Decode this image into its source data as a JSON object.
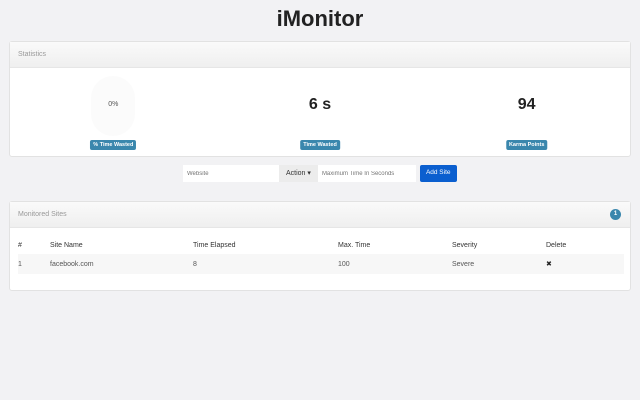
{
  "title": "iMonitor",
  "statistics": {
    "header": "Statistics",
    "percent_value": "0%",
    "percent_label": "% Time Wasted",
    "time_value": "6 s",
    "time_label": "Time Wasted",
    "karma_value": "94",
    "karma_label": "Karma Points"
  },
  "form": {
    "website_placeholder": "Website",
    "action_label": "Action",
    "max_time_placeholder": "Maximum Time In Seconds",
    "add_label": "Add Site"
  },
  "sites": {
    "header": "Monitored Sites",
    "count": "1",
    "columns": [
      "#",
      "Site Name",
      "Time Elapsed",
      "Max. Time",
      "Severity",
      "Delete"
    ],
    "rows": [
      {
        "index": "1",
        "site": "facebook.com",
        "elapsed": "8",
        "max": "100",
        "severity": "Severe",
        "delete": "✖"
      }
    ]
  }
}
